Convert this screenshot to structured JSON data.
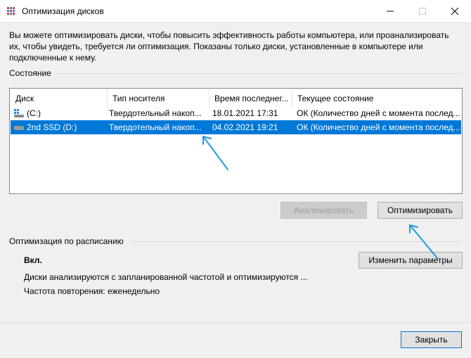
{
  "window": {
    "title": "Оптимизация дисков",
    "controls": {
      "minimize_icon": "minimize-icon",
      "maximize_icon": "maximize-icon",
      "close_icon": "close-icon"
    }
  },
  "intro_text": "Вы можете оптимизировать диски, чтобы повысить эффективность работы  компьютера, или проанализировать их, чтобы увидеть, требуется ли оптимизация. Показаны только диски, установленные в компьютере или подключенные к нему.",
  "status_section": {
    "label": "Состояние",
    "columns": [
      "Диск",
      "Тип носителя",
      "Время последнег...",
      "Текущее состояние"
    ],
    "rows": [
      {
        "disk": "(C:)",
        "media": "Твердотельный накоп...",
        "last_run": "18.01.2021 17:31",
        "status": "ОК (Количество дней с момента послед...",
        "selected": false,
        "icon": "windows-drive-icon"
      },
      {
        "disk": "2nd SSD (D:)",
        "media": "Твердотельный накоп...",
        "last_run": "04.02.2021 19:21",
        "status": "ОК (Количество дней с момента послед...",
        "selected": true,
        "icon": "drive-icon"
      }
    ]
  },
  "buttons": {
    "analyze": "Анализировать",
    "optimize": "Оптимизировать",
    "change_settings": "Изменить параметры",
    "close": "Закрыть"
  },
  "schedule_section": {
    "label": "Оптимизация по расписанию",
    "state": "Вкл.",
    "description": "Диски анализируются с запланированной частотой и оптимизируются ...",
    "frequency": "Частота повторения: еженедельно"
  },
  "colors": {
    "selection": "#0078d7",
    "annotation_arrow": "#1e9be0"
  }
}
